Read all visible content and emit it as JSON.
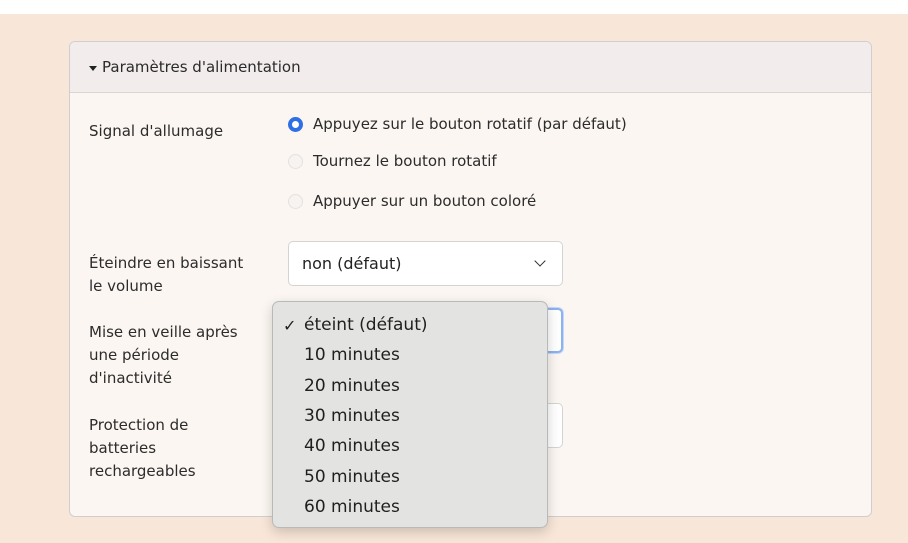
{
  "panel": {
    "title": "Paramètres d'alimentation"
  },
  "power_on_signal": {
    "label": "Signal d'allumage",
    "options": [
      {
        "label": "Appuyez sur le bouton rotatif (par défaut)",
        "checked": true
      },
      {
        "label": "Tournez le bouton rotatif",
        "checked": false
      },
      {
        "label": "Appuyer sur un bouton coloré",
        "checked": false
      }
    ]
  },
  "volume_off": {
    "label_line1": "Éteindre en baissant",
    "label_line2": "le volume",
    "value": "non (défaut)"
  },
  "sleep": {
    "label_line1": "Mise en veille après",
    "label_line2": "une période",
    "label_line3": "d'inactivité"
  },
  "battery": {
    "label_line1": "Protection de",
    "label_line2": "batteries",
    "label_line3": "rechargeables"
  },
  "dropdown": {
    "checkmark": "✓",
    "options": [
      "éteint (défaut)",
      "10 minutes",
      "20 minutes",
      "30 minutes",
      "40 minutes",
      "50 minutes",
      "60 minutes"
    ],
    "selected_index": 0
  },
  "colors": {
    "accent": "#2f6fe6",
    "page_background": "#f8e6d8",
    "focus_ring": "#8db2ee"
  }
}
